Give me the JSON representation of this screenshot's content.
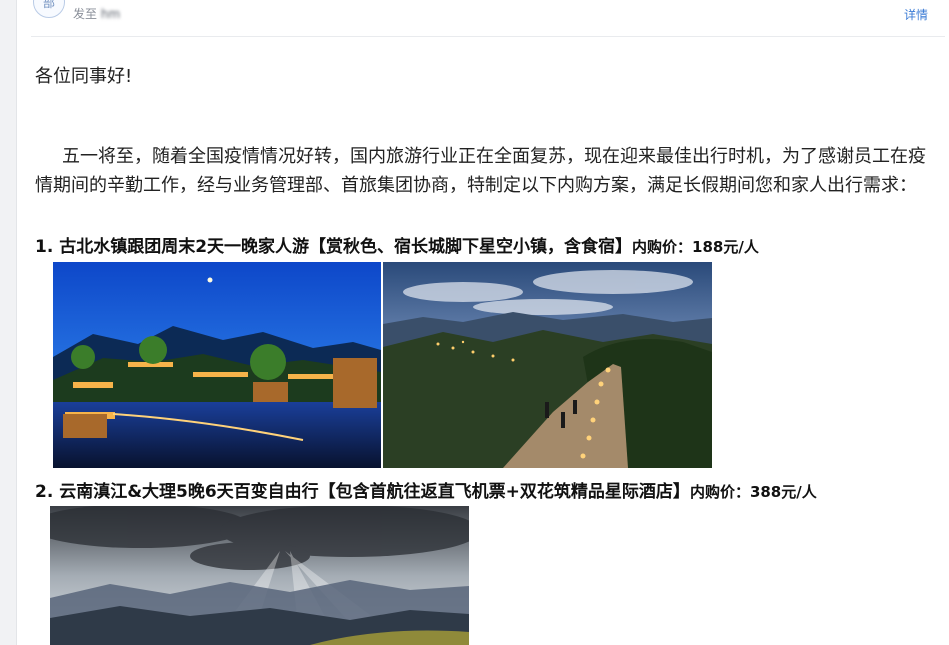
{
  "header": {
    "avatar_text": "部",
    "sendto_label": "发至",
    "recipient": "hm",
    "details_link": "详情"
  },
  "email": {
    "greeting": "各位同事好!",
    "paragraph": "五一将至，随着全国疫情情况好转，国内旅游行业正在全面复苏，现在迎来最佳出行时机，为了感谢员工在疫情期间的辛勤工作，经与业务管理部、首旅集团协商，特制定以下内购方案，满足长假期间您和家人出行需求：",
    "items": [
      {
        "title": "1. 古北水镇跟团周末2天一晚家人游【赏秋色、宿长城脚下星空小镇，含食宿】",
        "price": "内购价：188元/人"
      },
      {
        "title": "2. 云南滇江&大理5晚6天百变自由行【包含首航往返直飞机票+双花筑精品星际酒店】",
        "price": "内购价：388元/人"
      }
    ]
  },
  "colors": {
    "link": "#3a7bd5",
    "text": "#222222"
  }
}
